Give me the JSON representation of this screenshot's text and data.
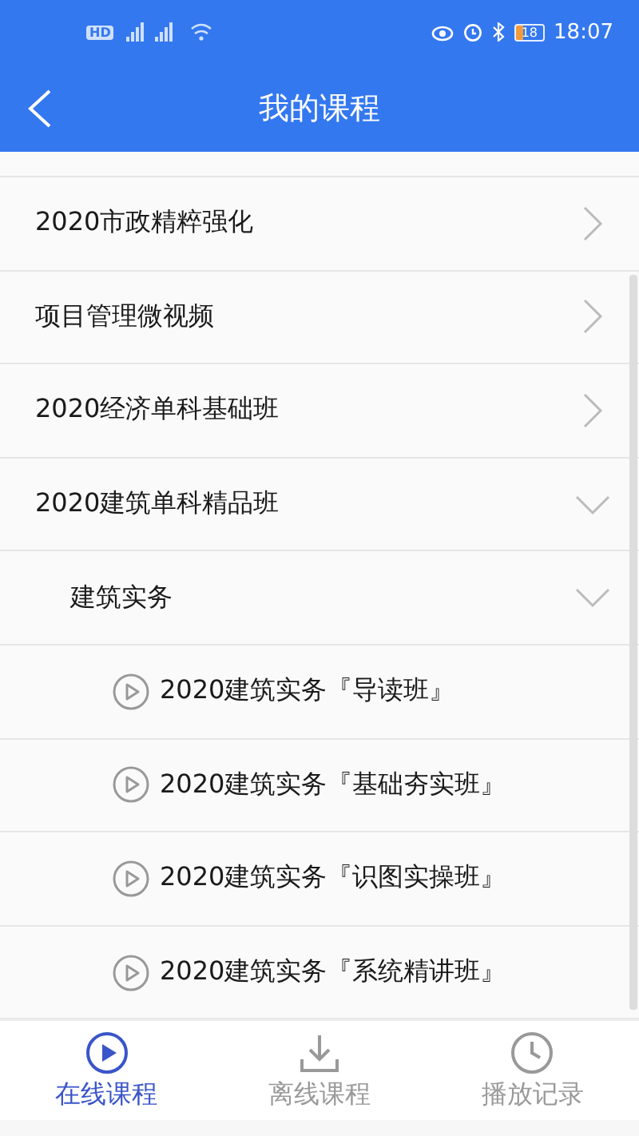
{
  "status_bar": {
    "hd_badge": "HD",
    "battery": "18",
    "time": "18:07"
  },
  "header": {
    "title": "我的课程"
  },
  "courses": [
    {
      "title": "2020市政精粹强化",
      "expanded": false
    },
    {
      "title": "项目管理微视频",
      "expanded": false
    },
    {
      "title": "2020经济单科基础班",
      "expanded": false
    },
    {
      "title": "2020建筑单科精品班",
      "expanded": true,
      "children": [
        {
          "title": "建筑实务",
          "expanded": true,
          "children": [
            {
              "title": "2020建筑实务『导读班』"
            },
            {
              "title": "2020建筑实务『基础夯实班』"
            },
            {
              "title": "2020建筑实务『识图实操班』"
            },
            {
              "title": "2020建筑实务『系统精讲班』"
            }
          ]
        }
      ]
    }
  ],
  "bottom_nav": [
    {
      "label": "在线课程",
      "kind": "play",
      "selected": true
    },
    {
      "label": "离线课程",
      "kind": "download",
      "selected": false
    },
    {
      "label": "播放记录",
      "kind": "history",
      "selected": false
    }
  ]
}
